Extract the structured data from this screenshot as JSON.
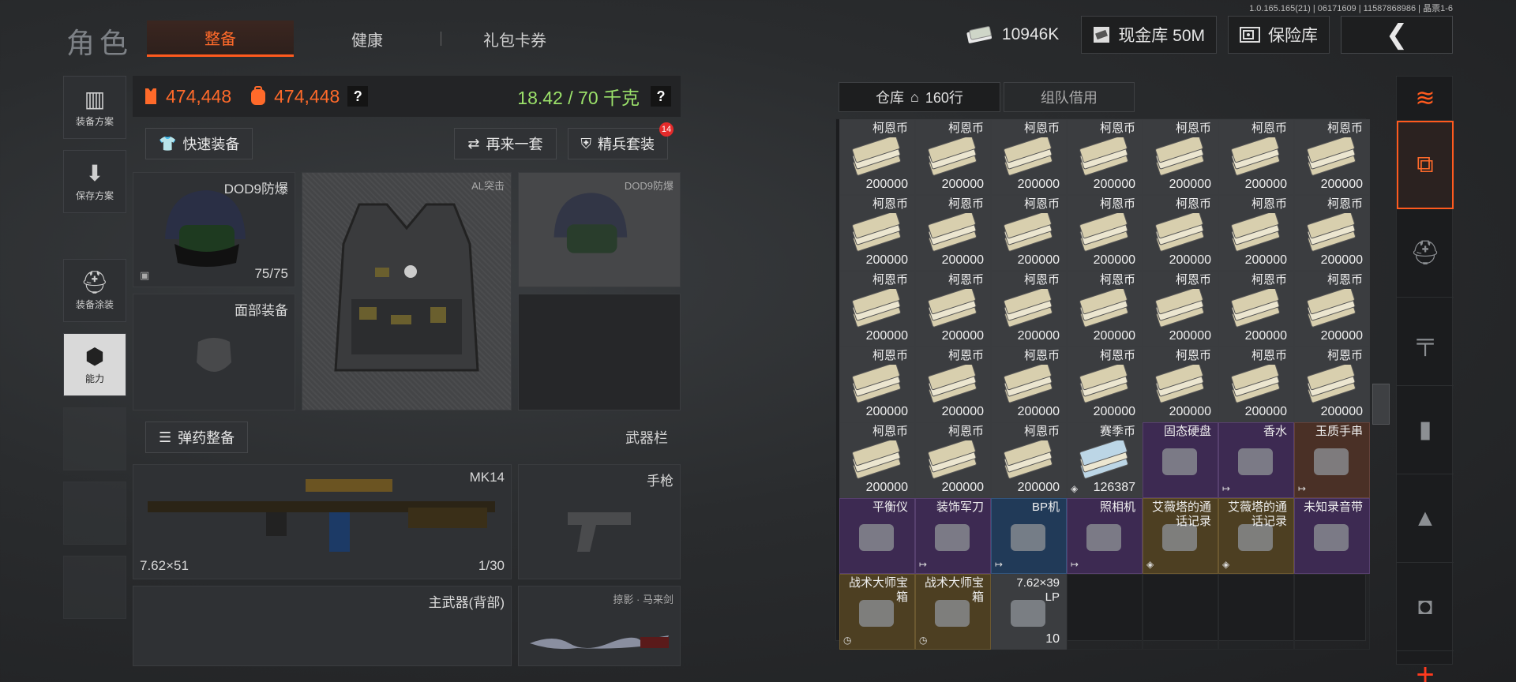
{
  "version": "1.0.165.165(21) | 06171609 | 11587868986 | 晶票1-6",
  "page_title": "角色",
  "tabs": [
    {
      "label": "整备",
      "active": true
    },
    {
      "label": "健康",
      "active": false
    },
    {
      "label": "礼包卡券",
      "active": false
    }
  ],
  "currency": {
    "money": "10946K",
    "cash_storage": "现金库 50M",
    "vault": "保险库"
  },
  "rail": [
    {
      "label": "装备方案",
      "icon": "vest-icon"
    },
    {
      "label": "保存方案",
      "icon": "download-icon"
    },
    {
      "label": "装备涂装",
      "icon": "paint-helmet-icon"
    },
    {
      "label": "能力",
      "icon": "ability-hex-icon",
      "active": true
    }
  ],
  "stats": {
    "armor_value": "474,448",
    "bag_value": "474,448",
    "weight": "18.42 / 70 千克"
  },
  "toolbar": {
    "quick_equip": "快速装备",
    "again": "再来一套",
    "elite_set": "精兵套装",
    "elite_badge": "14"
  },
  "slots": {
    "helmet": {
      "name": "DOD9防爆",
      "durability": "75/75"
    },
    "face": {
      "name": "面部装备"
    },
    "armor": {
      "name": "AL突击"
    },
    "helmet2": {
      "name": "DOD9防爆"
    }
  },
  "ammo_bar": {
    "button": "弹药整备",
    "right_label": "武器栏"
  },
  "weapons": {
    "primary": {
      "name": "MK14",
      "caliber": "7.62×51",
      "ammo": "1/30"
    },
    "pistol": {
      "name": "手枪"
    },
    "back": {
      "name": "主武器(背部)"
    },
    "melee": {
      "name": "掠影 · 马来剑"
    }
  },
  "storage": {
    "tab_main": "仓库",
    "rows": "160行",
    "tab_team": "组队借用"
  },
  "items": [
    {
      "name": "柯恩币",
      "qty": "200000",
      "color": "default"
    },
    {
      "name": "柯恩币",
      "qty": "200000",
      "color": "default"
    },
    {
      "name": "柯恩币",
      "qty": "200000",
      "color": "default"
    },
    {
      "name": "柯恩币",
      "qty": "200000",
      "color": "default"
    },
    {
      "name": "柯恩币",
      "qty": "200000",
      "color": "default"
    },
    {
      "name": "柯恩币",
      "qty": "200000",
      "color": "default"
    },
    {
      "name": "柯恩币",
      "qty": "200000",
      "color": "default"
    },
    {
      "name": "柯恩币",
      "qty": "200000",
      "color": "default"
    },
    {
      "name": "柯恩币",
      "qty": "200000",
      "color": "default"
    },
    {
      "name": "柯恩币",
      "qty": "200000",
      "color": "default"
    },
    {
      "name": "柯恩币",
      "qty": "200000",
      "color": "default"
    },
    {
      "name": "柯恩币",
      "qty": "200000",
      "color": "default"
    },
    {
      "name": "柯恩币",
      "qty": "200000",
      "color": "default"
    },
    {
      "name": "柯恩币",
      "qty": "200000",
      "color": "default"
    },
    {
      "name": "柯恩币",
      "qty": "200000",
      "color": "default"
    },
    {
      "name": "柯恩币",
      "qty": "200000",
      "color": "default"
    },
    {
      "name": "柯恩币",
      "qty": "200000",
      "color": "default"
    },
    {
      "name": "柯恩币",
      "qty": "200000",
      "color": "default"
    },
    {
      "name": "柯恩币",
      "qty": "200000",
      "color": "default"
    },
    {
      "name": "柯恩币",
      "qty": "200000",
      "color": "default"
    },
    {
      "name": "柯恩币",
      "qty": "200000",
      "color": "default"
    },
    {
      "name": "柯恩币",
      "qty": "200000",
      "color": "default"
    },
    {
      "name": "柯恩币",
      "qty": "200000",
      "color": "default"
    },
    {
      "name": "柯恩币",
      "qty": "200000",
      "color": "default"
    },
    {
      "name": "柯恩币",
      "qty": "200000",
      "color": "default"
    },
    {
      "name": "柯恩币",
      "qty": "200000",
      "color": "default"
    },
    {
      "name": "柯恩币",
      "qty": "200000",
      "color": "default"
    },
    {
      "name": "柯恩币",
      "qty": "200000",
      "color": "default"
    },
    {
      "name": "柯恩币",
      "qty": "200000",
      "color": "default"
    },
    {
      "name": "柯恩币",
      "qty": "200000",
      "color": "default"
    },
    {
      "name": "柯恩币",
      "qty": "200000",
      "color": "default"
    },
    {
      "name": "赛季币",
      "qty": "126387",
      "color": "default",
      "mark": "◈"
    },
    {
      "name": "固态硬盘",
      "qty": "",
      "color": "purple"
    },
    {
      "name": "香水",
      "qty": "",
      "color": "purple",
      "mark": "↦"
    },
    {
      "name": "玉质手串",
      "qty": "",
      "color": "brown",
      "mark": "↦"
    },
    {
      "name": "平衡仪",
      "qty": "",
      "color": "purple"
    },
    {
      "name": "装饰军刀",
      "qty": "",
      "color": "purple",
      "mark": "↦"
    },
    {
      "name": "BP机",
      "qty": "",
      "color": "blue",
      "mark": "↦"
    },
    {
      "name": "照相机",
      "qty": "",
      "color": "purple",
      "mark": "↦"
    },
    {
      "name": "艾薇塔的通\n话记录",
      "qty": "",
      "color": "gold",
      "mark": "◈"
    },
    {
      "name": "艾薇塔的通\n话记录",
      "qty": "",
      "color": "gold",
      "mark": "◈"
    },
    {
      "name": "未知录音带",
      "qty": "",
      "color": "purple"
    },
    {
      "name": "战术大师宝\n箱",
      "qty": "",
      "color": "gold",
      "mark": "◷"
    },
    {
      "name": "战术大师宝\n箱",
      "qty": "",
      "color": "gold",
      "mark": "◷"
    },
    {
      "name": "7.62×39\nLP",
      "qty": "10",
      "color": "default"
    }
  ],
  "colors": {
    "accent": "#ff5a1e",
    "weight": "#9be16a"
  }
}
